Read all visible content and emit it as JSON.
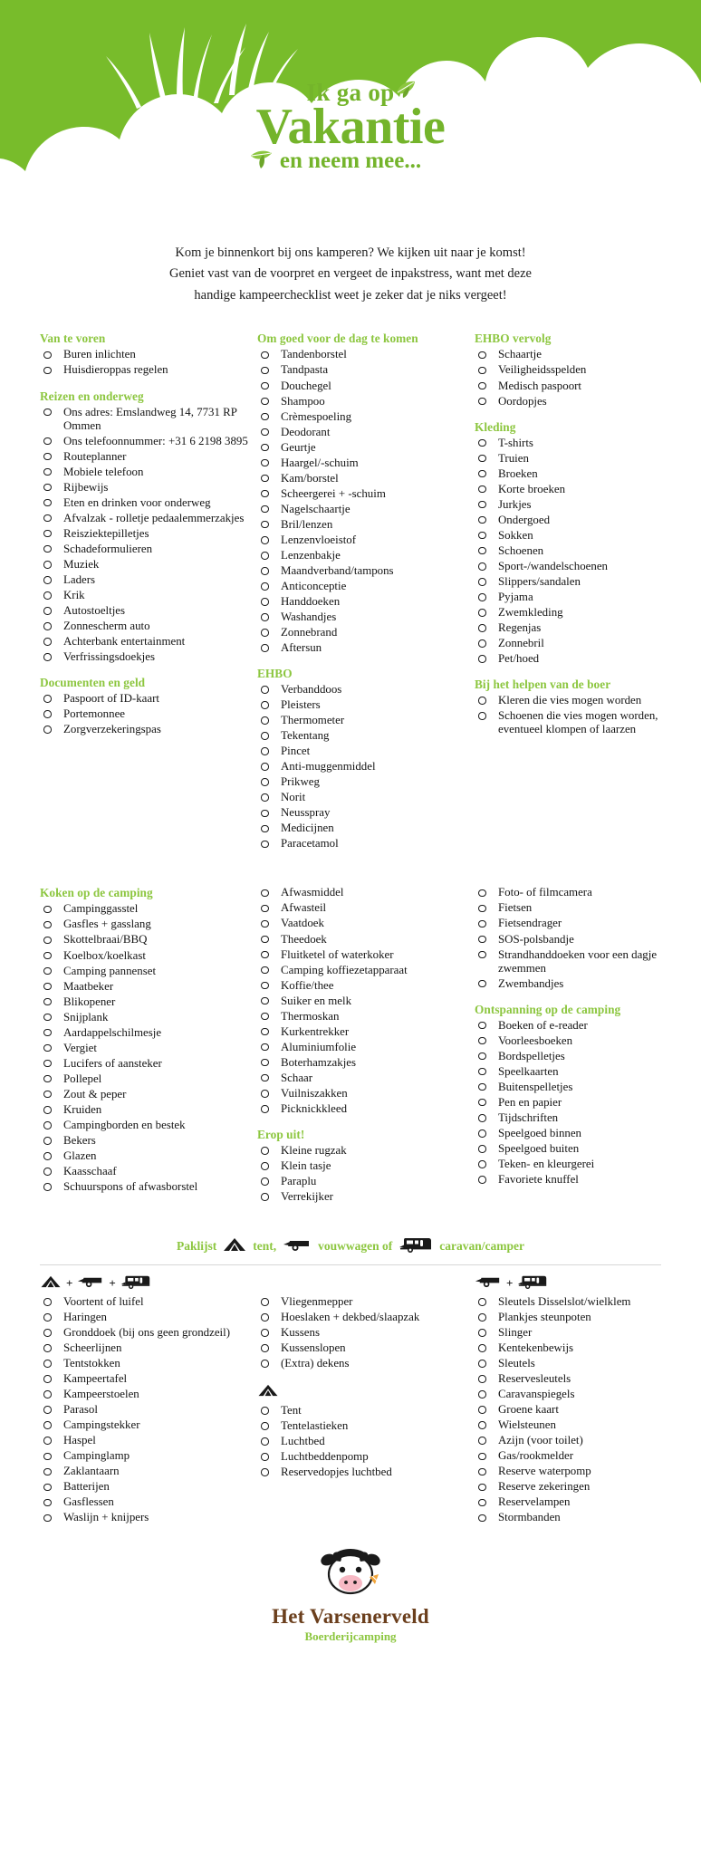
{
  "header": {
    "brand_green": "#74b42b",
    "title_line1": "Ik ga op",
    "title_line2": "Vakantie",
    "title_line3": "en neem mee...",
    "leaf_icon": "leaf-icon"
  },
  "intro": {
    "line1": "Kom je binnenkort bij ons kamperen? We kijken uit naar je komst!",
    "line2": "Geniet vast van de voorpret en vergeet de inpakstress, want met deze",
    "line3": "handige kampeerchecklist weet je zeker dat je niks vergeet!"
  },
  "section1": {
    "col1": [
      {
        "title": "Van te voren",
        "items": [
          "Buren inlichten",
          "Huisdieroppas regelen"
        ]
      },
      {
        "title": "Reizen en onderweg",
        "items": [
          "Ons adres: Emslandweg 14, 7731 RP Ommen",
          "Ons telefoonnummer: +31 6 2198 3895",
          "Routeplanner",
          "Mobiele telefoon",
          "Rijbewijs",
          "Eten en drinken voor onderweg",
          "Afvalzak - rolletje pedaalemmerzakjes",
          "Reisziektepilletjes",
          "Schadeformulieren",
          "Muziek",
          "Laders",
          "Krik",
          "Autostoeltjes",
          "Zonnescherm auto",
          "Achterbank entertainment",
          "Verfrissingsdoekjes"
        ]
      },
      {
        "title": "Documenten en geld",
        "items": [
          "Paspoort of ID-kaart",
          "Portemonnee",
          "Zorgverzekeringspas"
        ]
      }
    ],
    "col2": [
      {
        "title": "Om goed voor de dag te komen",
        "items": [
          "Tandenborstel",
          "Tandpasta",
          "Douchegel",
          "Shampoo",
          "Crèmespoeling",
          "Deodorant",
          "Geurtje",
          "Haargel/-schuim",
          "Kam/borstel",
          "Scheergerei + -schuim",
          "Nagelschaartje",
          "Bril/lenzen",
          "Lenzenvloeistof",
          "Lenzenbakje",
          "Maandverband/tampons",
          "Anticonceptie",
          "Handdoeken",
          "Washandjes",
          "Zonnebrand",
          "Aftersun"
        ]
      },
      {
        "title": "EHBO",
        "items": [
          "Verbanddoos",
          "Pleisters",
          "Thermometer",
          "Tekentang",
          "Pincet",
          "Anti-muggenmiddel",
          "Prikweg",
          "Norit",
          "Neusspray",
          "Medicijnen",
          "Paracetamol"
        ]
      }
    ],
    "col3": [
      {
        "title": "EHBO vervolg",
        "items": [
          "Schaartje",
          "Veiligheidsspelden",
          "Medisch paspoort",
          "Oordopjes"
        ]
      },
      {
        "title": "Kleding",
        "items": [
          "T-shirts",
          "Truien",
          "Broeken",
          "Korte broeken",
          "Jurkjes",
          "Ondergoed",
          "Sokken",
          "Schoenen",
          "Sport-/wandelschoenen",
          "Slippers/sandalen",
          "Pyjama",
          "Zwemkleding",
          "Regenjas",
          "Zonnebril",
          "Pet/hoed"
        ]
      },
      {
        "title": "Bij het helpen van de boer",
        "items": [
          "Kleren die vies mogen worden",
          "Schoenen die vies mogen worden, eventueel klompen of laarzen"
        ]
      }
    ]
  },
  "section2": {
    "col1": [
      {
        "title": "Koken op de camping",
        "items": [
          "Campinggasstel",
          "Gasfles + gasslang",
          "Skottelbraai/BBQ",
          "Koelbox/koelkast",
          "Camping pannenset",
          "Maatbeker",
          "Blikopener",
          "Snijplank",
          "Aardappelschilmesje",
          "Vergiet",
          "Lucifers of aansteker",
          "Pollepel",
          "Zout & peper",
          "Kruiden",
          "Campingborden en bestek",
          "Bekers",
          "Glazen",
          "Kaasschaaf",
          "Schuurspons of afwasborstel"
        ]
      }
    ],
    "col2": [
      {
        "title": "",
        "items": [
          "Afwasmiddel",
          "Afwasteil",
          "Vaatdoek",
          "Theedoek",
          "Fluitketel of waterkoker",
          "Camping koffiezetapparaat",
          "Koffie/thee",
          "Suiker en melk",
          "Thermoskan",
          "Kurkentrekker",
          "Aluminiumfolie",
          "Boterhamzakjes",
          "Schaar",
          "Vuilniszakken",
          "Picknickkleed"
        ]
      },
      {
        "title": "Erop uit!",
        "items": [
          "Kleine rugzak",
          "Klein tasje",
          "Paraplu",
          "Verrekijker"
        ]
      }
    ],
    "col3": [
      {
        "title": "",
        "items": [
          "Foto- of filmcamera",
          "Fietsen",
          "Fietsendrager",
          "SOS-polsbandje",
          "Strandhanddoeken voor een dagje zwemmen",
          "Zwembandjes"
        ]
      },
      {
        "title": "Ontspanning op de camping",
        "items": [
          "Boeken of e-reader",
          "Voorleesboeken",
          "Bordspelletjes",
          "Speelkaarten",
          "Buitenspelletjes",
          "Pen en papier",
          "Tijdschriften",
          "Speelgoed binnen",
          "Speelgoed buiten",
          "Teken- en kleurgerei",
          "Favoriete knuffel"
        ]
      }
    ]
  },
  "paklijst": {
    "label": "Paklijst",
    "tent_icon": "tent-icon",
    "tent_text": "tent,",
    "folding_icon": "folding-trailer-icon",
    "folding_text": "vouwwagen of",
    "caravan_icon": "caravan-icon",
    "caravan_text": "caravan/camper"
  },
  "section3": {
    "col1": {
      "icons": [
        "tent-icon",
        "folding-trailer-icon",
        "caravan-icon"
      ],
      "plus": "+",
      "items": [
        "Voortent of luifel",
        "Haringen",
        "Gronddoek (bij ons geen grondzeil)",
        "Scheerlijnen",
        "Tentstokken",
        "Kampeertafel",
        "Kampeerstoelen",
        "Parasol",
        "Campingstekker",
        "Haspel",
        "Campinglamp",
        "Zaklantaarn",
        "Batterijen",
        "Gasflessen",
        "Waslijn + knijpers"
      ]
    },
    "col2": {
      "group_a_items": [
        "Vliegenmepper",
        "Hoeslaken + dekbed/slaapzak",
        "Kussens",
        "Kussenslopen",
        "(Extra) dekens"
      ],
      "group_b_icon": "tent-icon",
      "group_b_items": [
        "Tent",
        "Tentelastieken",
        "Luchtbed",
        "Luchtbeddenpomp",
        "Reservedopjes luchtbed"
      ]
    },
    "col3": {
      "icons": [
        "folding-trailer-icon",
        "caravan-icon"
      ],
      "plus": "+",
      "items": [
        "Sleutels Disselslot/wielklem",
        "Plankjes steunpoten",
        "Slinger",
        "Kentekenbewijs",
        "Sleutels",
        "Reservesleutels",
        "Caravanspiegels",
        "Groene kaart",
        "Wielsteunen",
        "Azijn (voor toilet)",
        "Gas/rookmelder",
        "Reserve waterpomp",
        "Reserve zekeringen",
        "Reservelampen",
        "Stormbanden"
      ]
    }
  },
  "footer": {
    "logo_icon": "cow-icon",
    "name": "Het Varsenerveld",
    "subtitle": "Boerderijcamping",
    "name_color": "#6b3f1d",
    "subtitle_color": "#8cc63f"
  }
}
